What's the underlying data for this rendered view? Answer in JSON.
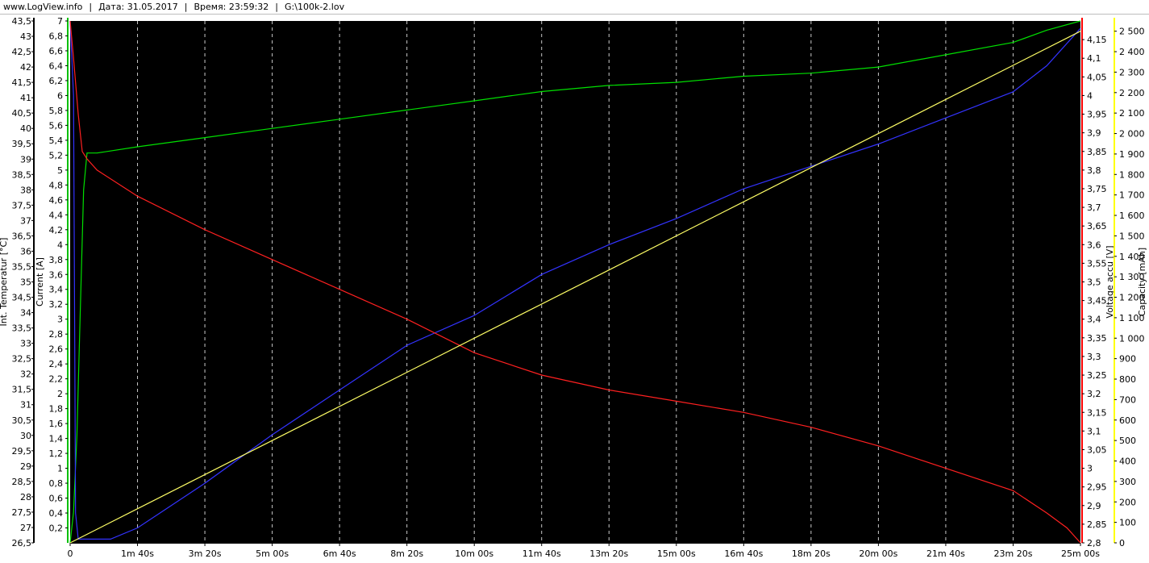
{
  "header": {
    "site": "www.LogView.info",
    "date": "Дата: 31.05.2017",
    "time": "Время: 23:59:32",
    "file": "G:\\100k-2.lov"
  },
  "chart_data": {
    "type": "line",
    "background": "#000000",
    "grid": "vertical dashed",
    "x": {
      "unit": "s",
      "range": [
        0,
        1500
      ],
      "ticks": [
        0,
        100,
        200,
        300,
        400,
        500,
        600,
        700,
        800,
        900,
        1000,
        1100,
        1200,
        1300,
        1400,
        1500
      ],
      "tick_labels": [
        "0",
        "1m 40s",
        "3m 20s",
        "5m 00s",
        "6m 40s",
        "8m 20s",
        "10m 00s",
        "11m 40s",
        "13m 20s",
        "15m 00s",
        "16m 40s",
        "18m 20s",
        "20m 00s",
        "21m 40s",
        "23m 20s",
        "25m 00s"
      ]
    },
    "axes": {
      "temperature": {
        "label": "Int. Temperatur [°C]",
        "color": "#000000",
        "range": [
          26.5,
          43.5
        ],
        "tick_labels": [
          "26,5",
          "27",
          "27,5",
          "28",
          "28,5",
          "29",
          "29,5",
          "30",
          "30,5",
          "31",
          "31,5",
          "32",
          "32,5",
          "33",
          "33,5",
          "34",
          "34,5",
          "35",
          "35,5",
          "36",
          "36,5",
          "37",
          "37,5",
          "38",
          "38,5",
          "39",
          "39,5",
          "40",
          "40,5",
          "41",
          "41,5",
          "42",
          "42,5",
          "43",
          "43,5"
        ]
      },
      "current": {
        "label": "Current [A]",
        "color": "#00c000",
        "range": [
          0,
          7
        ],
        "tick_labels": [
          "0,2",
          "0,4",
          "0,6",
          "0,8",
          "1",
          "1,2",
          "1,4",
          "1,6",
          "1,8",
          "2",
          "2,2",
          "2,4",
          "2,6",
          "2,8",
          "3",
          "3,2",
          "3,4",
          "3,6",
          "3,8",
          "4",
          "4,2",
          "4,4",
          "4,6",
          "4,8",
          "5",
          "5,2",
          "5,4",
          "5,6",
          "5,8",
          "6",
          "6,2",
          "6,4",
          "6,6",
          "6,8",
          "7"
        ]
      },
      "voltage": {
        "label": "Voltage accu [V]",
        "color": "#ff0000",
        "range": [
          2.8,
          4.2
        ],
        "tick_labels": [
          "2,8",
          "2,85",
          "2,9",
          "2,95",
          "3",
          "3,05",
          "3,1",
          "3,15",
          "3,2",
          "3,25",
          "3,3",
          "3,35",
          "3,4",
          "3,45",
          "3,5",
          "3,55",
          "3,6",
          "3,65",
          "3,7",
          "3,75",
          "3,8",
          "3,85",
          "3,9",
          "3,95",
          "4",
          "4,05",
          "4,1",
          "4,15"
        ]
      },
      "capacity": {
        "label": "Capacity [mAh]",
        "color": "#ffff00",
        "range": [
          0,
          2550
        ],
        "tick_labels": [
          "0",
          "100",
          "200",
          "300",
          "400",
          "500",
          "600",
          "700",
          "800",
          "900",
          "1 000",
          "1 100",
          "1 200",
          "1 300",
          "1 400",
          "1 500",
          "1 600",
          "1 700",
          "1 800",
          "1 900",
          "2 000",
          "2 100",
          "2 200",
          "2 300",
          "2 400",
          "2 500"
        ]
      }
    },
    "series": [
      {
        "name": "Int. Temperatur [°C]",
        "axis": "temperature",
        "color": "#00e000",
        "points": [
          [
            0,
            26.5
          ],
          [
            5,
            27.5
          ],
          [
            10,
            30
          ],
          [
            15,
            34
          ],
          [
            20,
            38
          ],
          [
            25,
            39.2
          ],
          [
            40,
            39.2
          ],
          [
            100,
            39.4
          ],
          [
            200,
            39.7
          ],
          [
            300,
            40.0
          ],
          [
            400,
            40.3
          ],
          [
            500,
            40.6
          ],
          [
            600,
            40.9
          ],
          [
            700,
            41.2
          ],
          [
            800,
            41.4
          ],
          [
            900,
            41.5
          ],
          [
            1000,
            41.7
          ],
          [
            1100,
            41.8
          ],
          [
            1200,
            42.0
          ],
          [
            1300,
            42.4
          ],
          [
            1400,
            42.8
          ],
          [
            1450,
            43.2
          ],
          [
            1500,
            43.5
          ]
        ]
      },
      {
        "name": "Current [A]",
        "axis": "current",
        "color": "#3333ff",
        "points": [
          [
            0,
            7.0
          ],
          [
            5,
            6.0
          ],
          [
            8,
            0.4
          ],
          [
            12,
            0.05
          ],
          [
            60,
            0.05
          ],
          [
            100,
            0.2
          ],
          [
            200,
            0.8
          ],
          [
            300,
            1.45
          ],
          [
            400,
            2.05
          ],
          [
            500,
            2.65
          ],
          [
            600,
            3.05
          ],
          [
            700,
            3.6
          ],
          [
            800,
            4.0
          ],
          [
            900,
            4.35
          ],
          [
            1000,
            4.75
          ],
          [
            1100,
            5.05
          ],
          [
            1200,
            5.35
          ],
          [
            1300,
            5.7
          ],
          [
            1400,
            6.05
          ],
          [
            1450,
            6.4
          ],
          [
            1500,
            6.9
          ]
        ]
      },
      {
        "name": "Voltage accu [V]",
        "axis": "voltage",
        "color": "#ff2020",
        "points": [
          [
            0,
            4.2
          ],
          [
            5,
            4.1
          ],
          [
            12,
            3.95
          ],
          [
            18,
            3.85
          ],
          [
            25,
            3.83
          ],
          [
            40,
            3.8
          ],
          [
            100,
            3.73
          ],
          [
            200,
            3.64
          ],
          [
            300,
            3.56
          ],
          [
            400,
            3.48
          ],
          [
            500,
            3.4
          ],
          [
            600,
            3.31
          ],
          [
            700,
            3.25
          ],
          [
            800,
            3.21
          ],
          [
            900,
            3.18
          ],
          [
            1000,
            3.15
          ],
          [
            1100,
            3.11
          ],
          [
            1200,
            3.06
          ],
          [
            1300,
            3.0
          ],
          [
            1400,
            2.94
          ],
          [
            1450,
            2.88
          ],
          [
            1480,
            2.84
          ],
          [
            1500,
            2.8
          ]
        ]
      },
      {
        "name": "Capacity [mAh]",
        "axis": "capacity",
        "color": "#ffff66",
        "points": [
          [
            0,
            0
          ],
          [
            1500,
            2500
          ]
        ]
      }
    ]
  }
}
